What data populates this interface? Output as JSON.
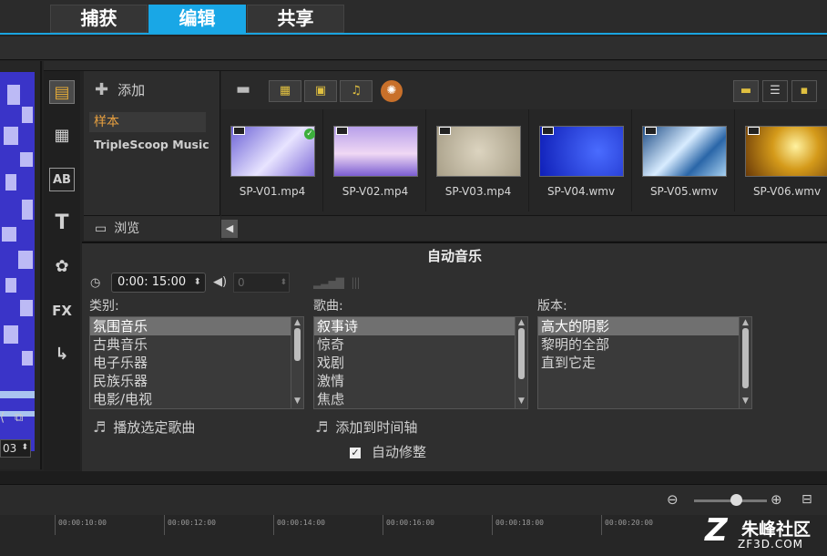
{
  "tabs": [
    {
      "label": "捕获",
      "active": false
    },
    {
      "label": "编辑",
      "active": true
    },
    {
      "label": "共享",
      "active": false
    }
  ],
  "preview": {
    "time_suffix": "03"
  },
  "library": {
    "add_label": "添加",
    "folders": [
      "样本",
      "TripleScoop Music"
    ],
    "browse_label": "浏览",
    "thumbnails": [
      {
        "name": "SP-V01.mp4",
        "color": "#8f88e0",
        "checked": true
      },
      {
        "name": "SP-V02.mp4",
        "color": "#b09ce6",
        "checked": false
      },
      {
        "name": "SP-V03.mp4",
        "color": "#c9bfa8",
        "checked": false
      },
      {
        "name": "SP-V04.wmv",
        "color": "#1f2fd8",
        "checked": false
      },
      {
        "name": "SP-V05.wmv",
        "color": "#7fb0e0",
        "checked": false
      },
      {
        "name": "SP-V06.wmv",
        "color": "#d6a52a",
        "checked": false
      }
    ]
  },
  "auto_music": {
    "title": "自动音乐",
    "duration": "0:00: 15:00",
    "volume": "0",
    "category_label": "类别:",
    "categories": [
      "氛围音乐",
      "古典音乐",
      "电子乐器",
      "民族乐器",
      "电影/电视"
    ],
    "song_label": "歌曲:",
    "songs": [
      "叙事诗",
      "惊奇",
      "戏剧",
      "激情",
      "焦虑"
    ],
    "version_label": "版本:",
    "versions": [
      "高大的阴影",
      "黎明的全部",
      "直到它走"
    ],
    "play_label": "播放选定歌曲",
    "add_timeline_label": "添加到时间轴",
    "auto_trim_label": "自动修整",
    "auto_trim_checked": true
  },
  "timeline": {
    "ticks": [
      "00:00:10:00",
      "00:00:12:00",
      "00:00:14:00",
      "00:00:16:00",
      "00:00:18:00",
      "00:00:20:00"
    ]
  },
  "watermark": {
    "name": "朱峰社区",
    "url": "ZF3D.COM"
  }
}
